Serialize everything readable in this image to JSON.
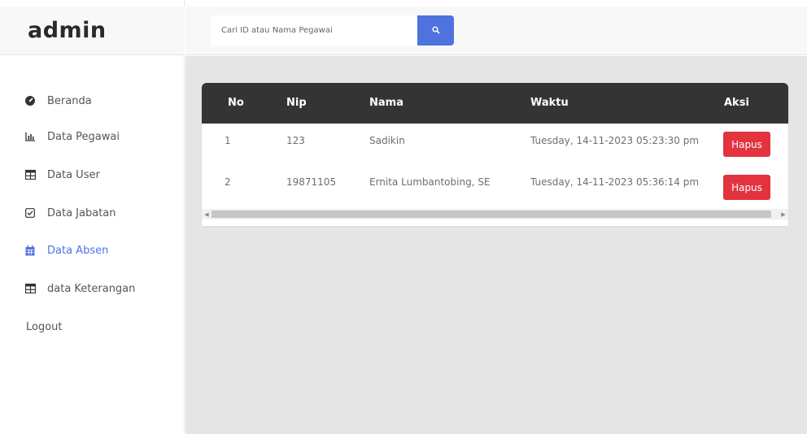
{
  "brand": {
    "title": "admin"
  },
  "search": {
    "placeholder": "Cari ID atau Nama Pegawai",
    "button_icon": "search-icon"
  },
  "sidebar": {
    "items": [
      {
        "label": "Beranda",
        "icon": "tachometer-icon",
        "active": false
      },
      {
        "label": "Data Pegawai",
        "icon": "bar-chart-icon",
        "active": false
      },
      {
        "label": "Data User",
        "icon": "table-icon",
        "active": false
      },
      {
        "label": "Data Jabatan",
        "icon": "check-square-icon",
        "active": false
      },
      {
        "label": "Data Absen",
        "icon": "calendar-icon",
        "active": true
      },
      {
        "label": "data Keterangan",
        "icon": "table-icon",
        "active": false
      }
    ],
    "logout": "Logout"
  },
  "table": {
    "headers": [
      "No",
      "Nip",
      "Nama",
      "Waktu",
      "Aksi"
    ],
    "rows": [
      {
        "no": "1",
        "nip": "123",
        "nama": "Sadikin",
        "waktu": "Tuesday, 14-11-2023 05:23:30 pm",
        "aksi": "Hapus"
      },
      {
        "no": "2",
        "nip": "19871105",
        "nama": "Ernita Lumbantobing, SE",
        "waktu": "Tuesday, 14-11-2023 05:36:14 pm",
        "aksi": "Hapus"
      }
    ]
  },
  "colors": {
    "accent": "#4e73df",
    "danger": "#e2333f",
    "table_header": "#343434",
    "content_bg": "#e5e5e5"
  }
}
